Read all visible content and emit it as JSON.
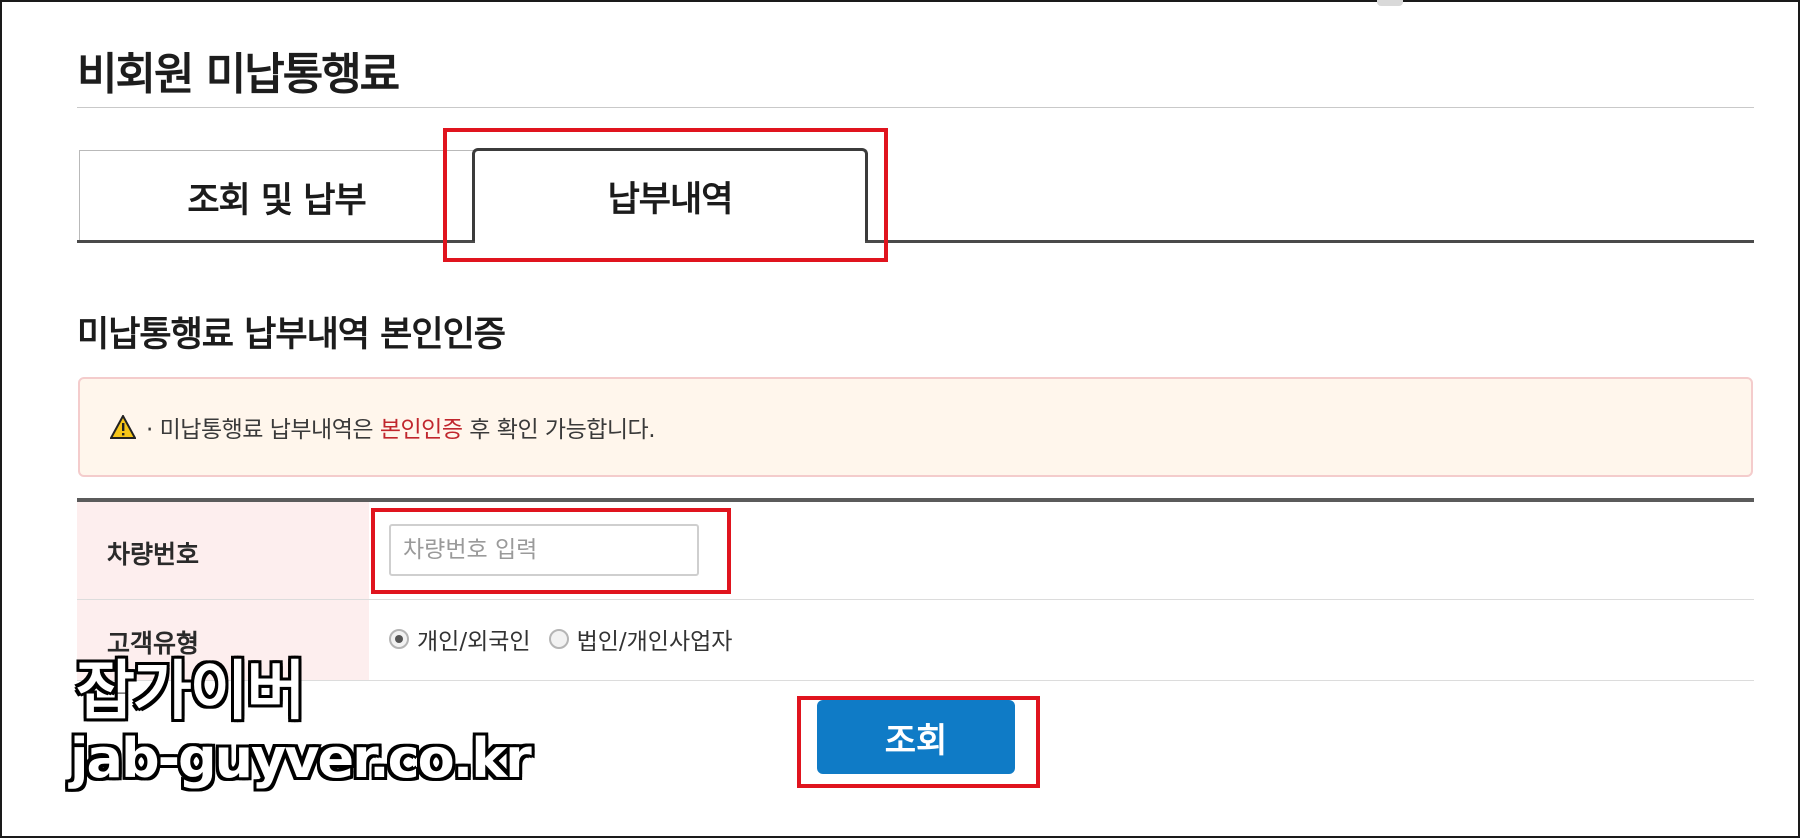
{
  "page": {
    "title": "비회원 미납통행료"
  },
  "tabs": [
    {
      "label": "조회 및 납부",
      "active": false
    },
    {
      "label": "납부내역",
      "active": true
    }
  ],
  "section": {
    "title": "미납통행료 납부내역 본인인증"
  },
  "notice": {
    "icon": "warning-icon",
    "text_before": "· 미납통행료 납부내역은 ",
    "highlight": "본인인증",
    "text_after": " 후 확인 가능합니다.",
    "highlight_color": "#c0262d"
  },
  "form": {
    "vehicle": {
      "label": "차량번호",
      "placeholder": "차량번호 입력",
      "value": ""
    },
    "customer_type": {
      "label": "고객유형",
      "options": [
        {
          "label": "개인/외국인",
          "selected": true
        },
        {
          "label": "법인/개인사업자",
          "selected": false
        }
      ]
    }
  },
  "actions": {
    "search_label": "조회",
    "search_color": "#0f7bc6"
  },
  "annotations": {
    "color": "#e0141e"
  },
  "watermark": {
    "name": "잡가이버",
    "url": "jab-guyver.co.kr"
  }
}
